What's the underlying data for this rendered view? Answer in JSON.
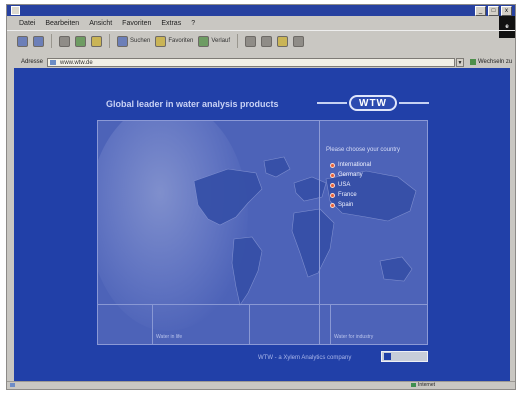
{
  "window": {
    "title": "",
    "controls": [
      "_",
      "□",
      "x"
    ]
  },
  "menubar": {
    "items": [
      "Datei",
      "Bearbeiten",
      "Ansicht",
      "Favoriten",
      "Extras",
      "?"
    ]
  },
  "toolbar": {
    "buttons": [
      {
        "label": "",
        "icon": "back-icon"
      },
      {
        "label": "",
        "icon": "forward-icon"
      },
      {
        "label": "",
        "icon": "stop-icon"
      },
      {
        "label": "",
        "icon": "refresh-icon"
      },
      {
        "label": "",
        "icon": "home-icon"
      },
      {
        "label": "Suchen",
        "icon": "search-icon"
      },
      {
        "label": "Favoriten",
        "icon": "favorites-icon"
      },
      {
        "label": "Verlauf",
        "icon": "history-icon"
      },
      {
        "label": "",
        "icon": "mail-icon"
      },
      {
        "label": "",
        "icon": "print-icon"
      },
      {
        "label": "",
        "icon": "edit-icon"
      },
      {
        "label": "",
        "icon": "discuss-icon"
      }
    ]
  },
  "address": {
    "label": "Adresse",
    "url": "www.wtw.de",
    "go_label": "Wechseln zu"
  },
  "page": {
    "headline": "Global leader in water analysis products",
    "logo_text": "WTW",
    "country_prompt": "Please choose your country",
    "countries": [
      "International",
      "Germany",
      "USA",
      "France",
      "Spain"
    ],
    "thumbnails": [
      "",
      "Water in life",
      "",
      "Water for industry"
    ],
    "footer_text": "WTW - a Xylem Analytics company"
  },
  "status": {
    "zone_label": "Internet"
  },
  "colors": {
    "page_background": "#2140a8",
    "panel": "#4d63b8",
    "bullet": "#e8623a",
    "titlebar": "#2741a0"
  }
}
